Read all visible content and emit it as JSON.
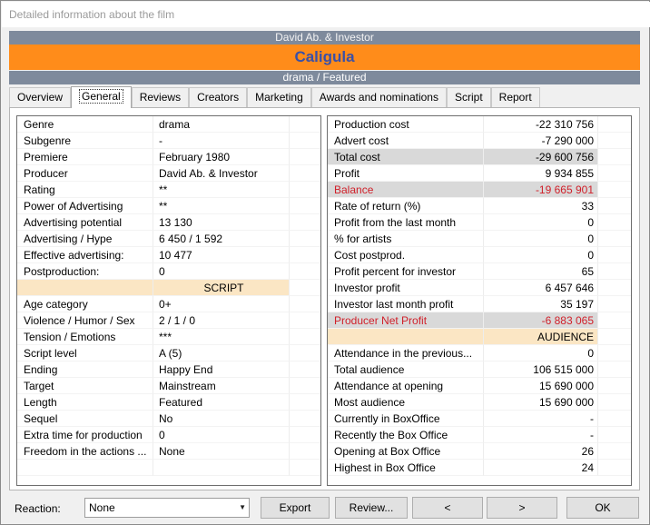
{
  "window": {
    "title": "Detailed information about the film"
  },
  "film": {
    "author": "David Ab. & Investor",
    "title": "Caligula",
    "genre_line": "drama / Featured"
  },
  "tabs": [
    {
      "label": "Overview"
    },
    {
      "label": "General",
      "active": true
    },
    {
      "label": "Reviews"
    },
    {
      "label": "Creators"
    },
    {
      "label": "Marketing"
    },
    {
      "label": "Awards and nominations"
    },
    {
      "label": "Script"
    },
    {
      "label": "Report"
    }
  ],
  "left_rows": [
    {
      "label": "Genre",
      "value": "drama"
    },
    {
      "label": "Subgenre",
      "value": "-"
    },
    {
      "label": "Premiere",
      "value": "February 1980"
    },
    {
      "label": "Producer",
      "value": "David Ab. & Investor"
    },
    {
      "label": "Rating",
      "value": "**"
    },
    {
      "label": "Power of Advertising",
      "value": "**"
    },
    {
      "label": "Advertising potential",
      "value": "13 130"
    },
    {
      "label": "Advertising / Hype",
      "value": "6 450 / 1 592"
    },
    {
      "label": "Effective advertising:",
      "value": "10 477"
    },
    {
      "label": "Postproduction:",
      "value": "0"
    },
    {
      "label": "",
      "value": "SCRIPT",
      "section": true
    },
    {
      "label": "Age category",
      "value": "0+"
    },
    {
      "label": "Violence / Humor / Sex",
      "value": "2 / 1 / 0"
    },
    {
      "label": "Tension / Emotions",
      "value": "***"
    },
    {
      "label": "Script level",
      "value": "A (5)"
    },
    {
      "label": "Ending",
      "value": "Happy End"
    },
    {
      "label": "Target",
      "value": "Mainstream"
    },
    {
      "label": "Length",
      "value": "Featured"
    },
    {
      "label": "Sequel",
      "value": "No"
    },
    {
      "label": "Extra time for production",
      "value": "0"
    },
    {
      "label": "Freedom in the actions ...",
      "value": "None"
    },
    {
      "label": "",
      "value": ""
    }
  ],
  "right_rows": [
    {
      "label": "Production cost",
      "value": "-22 310 756"
    },
    {
      "label": "Advert cost",
      "value": "-7 290 000"
    },
    {
      "label": "Total cost",
      "value": "-29 600 756",
      "highlight": true
    },
    {
      "label": "Profit",
      "value": "9 934 855"
    },
    {
      "label": "Balance",
      "value": "-19 665 901",
      "highlight": true,
      "red": true
    },
    {
      "label": "Rate of return (%)",
      "value": "33"
    },
    {
      "label": "Profit from the last month",
      "value": "0"
    },
    {
      "label": "% for artists",
      "value": "0"
    },
    {
      "label": "Cost postprod.",
      "value": "0"
    },
    {
      "label": "Profit percent for investor",
      "value": "65"
    },
    {
      "label": "Investor profit",
      "value": "6 457 646"
    },
    {
      "label": "Investor last month profit",
      "value": "35 197"
    },
    {
      "label": "Producer Net Profit",
      "value": "-6 883 065",
      "highlight": true,
      "red": true
    },
    {
      "label": "",
      "value": "AUDIENCE",
      "section": true
    },
    {
      "label": "Attendance in the previous...",
      "value": "0"
    },
    {
      "label": "Total audience",
      "value": "106 515 000"
    },
    {
      "label": "Attendance at opening",
      "value": "15 690 000"
    },
    {
      "label": "Most audience",
      "value": "15 690 000"
    },
    {
      "label": "Currently in BoxOffice",
      "value": "-"
    },
    {
      "label": "Recently the Box Office",
      "value": "-"
    },
    {
      "label": "Opening at Box Office",
      "value": "26"
    },
    {
      "label": "Highest in Box Office",
      "value": "24"
    }
  ],
  "footer": {
    "reaction_label": "Reaction:",
    "reaction_value": "None",
    "export_label": "Export",
    "review_label": "Review...",
    "prev_label": "<",
    "next_label": ">",
    "ok_label": "OK"
  },
  "colors": {
    "band": "#7e8a9c",
    "title_band": "#ff8c1a",
    "title_text": "#3a50a8",
    "negative_text": "#d0202a",
    "section_bg": "#fbe6c4",
    "highlight_bg": "#d9d9d9"
  }
}
